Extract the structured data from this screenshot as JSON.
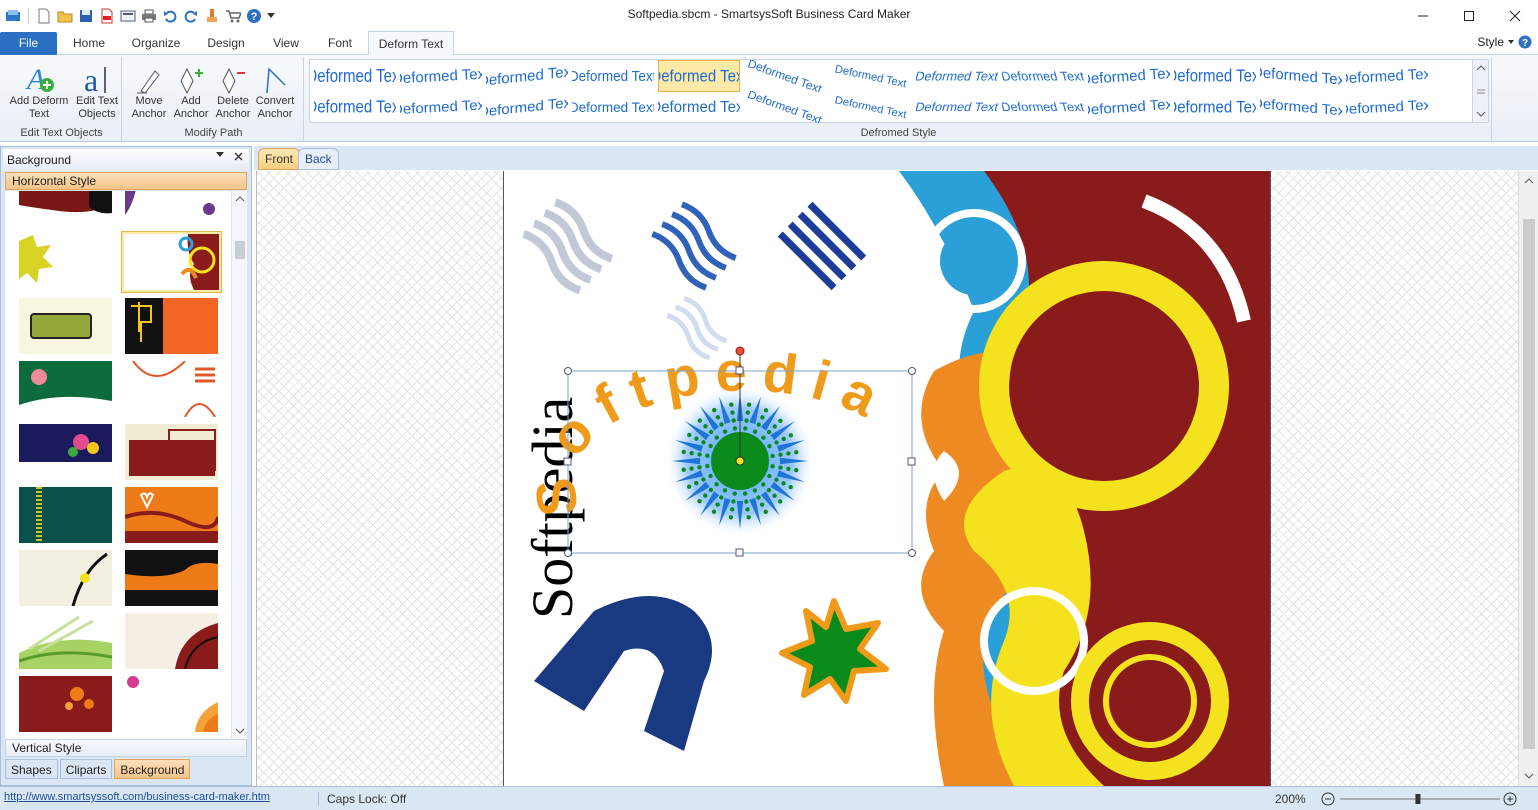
{
  "window": {
    "title": "Softpedia.sbcm - SmartsysSoft Business Card Maker"
  },
  "quick_access": [
    "app-icon",
    "new-icon",
    "open-icon",
    "save-icon",
    "pdf-icon",
    "print-preview-icon",
    "print-icon",
    "undo-icon",
    "redo-icon",
    "paint-icon",
    "cart-icon",
    "help-icon",
    "customize-dropdown-icon"
  ],
  "ribbon_tabs": [
    {
      "label": "File"
    },
    {
      "label": "Home"
    },
    {
      "label": "Organize"
    },
    {
      "label": "Design"
    },
    {
      "label": "View"
    },
    {
      "label": "Font"
    },
    {
      "label": "Deform Text",
      "active": true
    }
  ],
  "style_menu": "Style",
  "ribbon": {
    "groups": [
      {
        "label": "Edit Text Objects",
        "buttons": [
          "Add Deform Text",
          "Edit Text Objects"
        ]
      },
      {
        "label": "Modify Path",
        "buttons": [
          "Move Anchor",
          "Add Anchor",
          "Delete Anchor",
          "Convert Anchor"
        ]
      },
      {
        "label": "Defromed Style"
      }
    ],
    "gallery_item_text": "Deformed Text",
    "gallery_selected_index": 4
  },
  "left_panel": {
    "title": "Background",
    "horizontal_style": "Horizontal Style",
    "vertical_style": "Vertical Style",
    "tabs": [
      {
        "label": "Shapes"
      },
      {
        "label": "Cliparts"
      },
      {
        "label": "Background",
        "active": true
      }
    ]
  },
  "doc_tabs": [
    {
      "label": "Front",
      "active": true
    },
    {
      "label": "Back"
    }
  ],
  "card": {
    "vertical_text": "Softpedia",
    "arc_text": "Softpedia"
  },
  "status": {
    "link": "http://www.smartsyssoft.com/business-card-maker.htm",
    "caps_lock": "Caps Lock: Off",
    "zoom": "200%",
    "zoom_level_percent": 200
  },
  "colors": {
    "accent": "#2a6fc1",
    "panel": "#dbe6f4",
    "selected_tab": "#f6cf7c",
    "card_maroon": "#8a1b1b",
    "card_yellow": "#f5e21e",
    "card_orange": "#ee8a22",
    "card_blue": "#2a9fd8"
  }
}
